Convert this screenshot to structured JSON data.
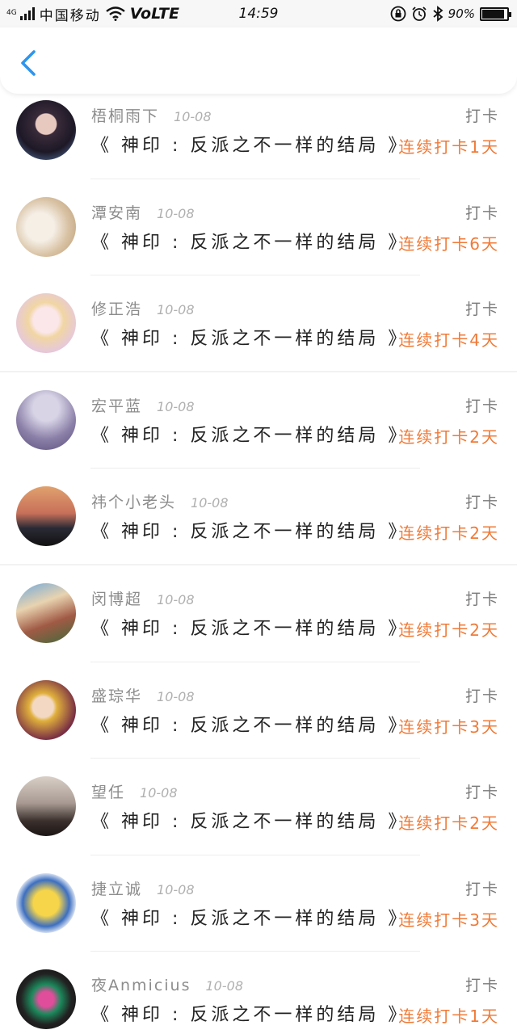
{
  "status_bar": {
    "network": "4G",
    "carrier": "中国移动",
    "volte": "VoLTE",
    "time": "14:59",
    "battery": "90%",
    "battery_level": 0.9
  },
  "nav": {
    "back_icon": "chevron-left-icon"
  },
  "colors": {
    "accent": "#2e95ee",
    "streak": "#f07a37",
    "meta": "#8c8c8c"
  },
  "rows": [
    {
      "name": "梧桐雨下",
      "date": "10-08",
      "action": "打卡",
      "book": "《 神印 : 反派之不一样的结局 》",
      "streak": "连续打卡1天"
    },
    {
      "name": "潭安南",
      "date": "10-08",
      "action": "打卡",
      "book": "《 神印 : 反派之不一样的结局 》",
      "streak": "连续打卡6天"
    },
    {
      "name": "修正浩",
      "date": "10-08",
      "action": "打卡",
      "book": "《 神印 : 反派之不一样的结局 》",
      "streak": "连续打卡4天"
    },
    {
      "name": "宏平蓝",
      "date": "10-08",
      "action": "打卡",
      "book": "《 神印 : 反派之不一样的结局 》",
      "streak": "连续打卡2天"
    },
    {
      "name": "祎个小老头",
      "date": "10-08",
      "action": "打卡",
      "book": "《 神印 : 反派之不一样的结局 》",
      "streak": "连续打卡2天"
    },
    {
      "name": "闵博超",
      "date": "10-08",
      "action": "打卡",
      "book": "《 神印 : 反派之不一样的结局 》",
      "streak": "连续打卡2天"
    },
    {
      "name": "盛琮华",
      "date": "10-08",
      "action": "打卡",
      "book": "《 神印 : 反派之不一样的结局 》",
      "streak": "连续打卡3天"
    },
    {
      "name": "望任",
      "date": "10-08",
      "action": "打卡",
      "book": "《 神印 : 反派之不一样的结局 》",
      "streak": "连续打卡2天"
    },
    {
      "name": "捷立诚",
      "date": "10-08",
      "action": "打卡",
      "book": "《 神印 : 反派之不一样的结局 》",
      "streak": "连续打卡3天"
    },
    {
      "name": "夜Anmicius",
      "date": "10-08",
      "action": "打卡",
      "book": "《 神印 : 反派之不一样的结局 》",
      "streak": "连续打卡1天"
    }
  ]
}
